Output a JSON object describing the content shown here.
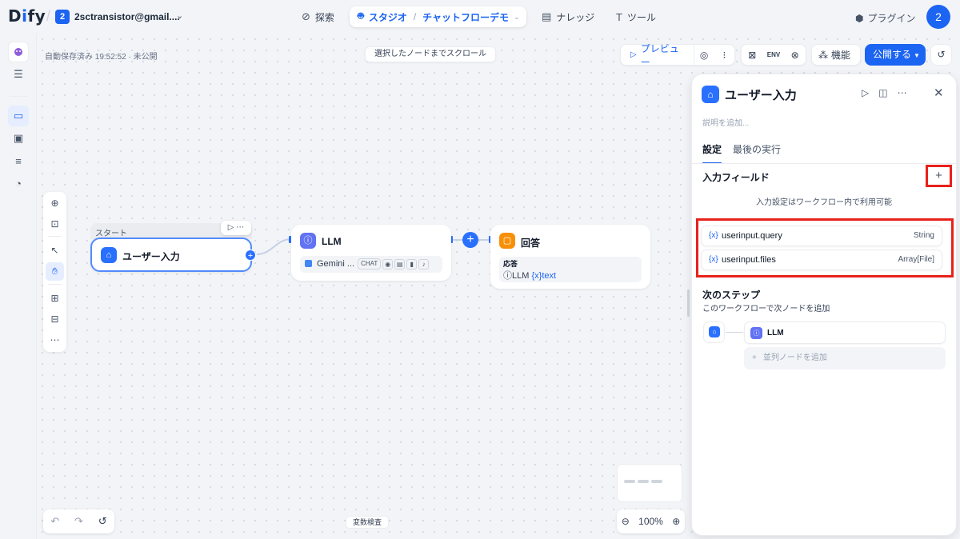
{
  "header": {
    "logo_main": "D",
    "logo_i": "i",
    "logo_rest": "fy",
    "workspace_badge": "2",
    "workspace_name": "2sctransistor@gmail....",
    "nav": {
      "explore": "探索",
      "studio": "スタジオ",
      "app_name": "チャットフローデモ",
      "knowledge": "ナレッジ",
      "tools": "ツール"
    },
    "plugin": "プラグイン",
    "avatar": "2"
  },
  "canvas": {
    "autosave": "自動保存済み 19:52:52 · 未公開",
    "scroll_to_node": "選択したノードまでスクロール",
    "toolbar": {
      "preview": "プレビュー",
      "env": "ENV",
      "features": "機能",
      "publish": "公開する"
    },
    "variable_inspect": "変数検査",
    "zoom": "100%"
  },
  "nodes": {
    "start": {
      "section_label": "スタート",
      "title": "ユーザー入力"
    },
    "llm": {
      "title": "LLM",
      "model": "Gemini ...",
      "mode": "CHAT"
    },
    "answer": {
      "title": "回答",
      "label": "応答",
      "ref_node": "LLM",
      "ref_var": "text",
      "var_icon": "{x}"
    }
  },
  "panel": {
    "title": "ユーザー入力",
    "description_placeholder": "説明を追加...",
    "tabs": [
      "設定",
      "最後の実行"
    ],
    "input_fields_title": "入力フィールド",
    "input_fields_hint": "入力設定はワークフロー内で利用可能",
    "fields": [
      {
        "name": "userinput.query",
        "type": "String"
      },
      {
        "name": "userinput.files",
        "type": "Array[File]"
      }
    ],
    "next_step_title": "次のステップ",
    "next_step_sub": "このワークフローで次ノードを追加",
    "next_node": "LLM",
    "add_parallel": "並列ノードを追加"
  },
  "colors": {
    "accent": "#1c64f2",
    "highlight": "#e8211b",
    "llm": "#6172f3",
    "answer": "#f79009"
  }
}
